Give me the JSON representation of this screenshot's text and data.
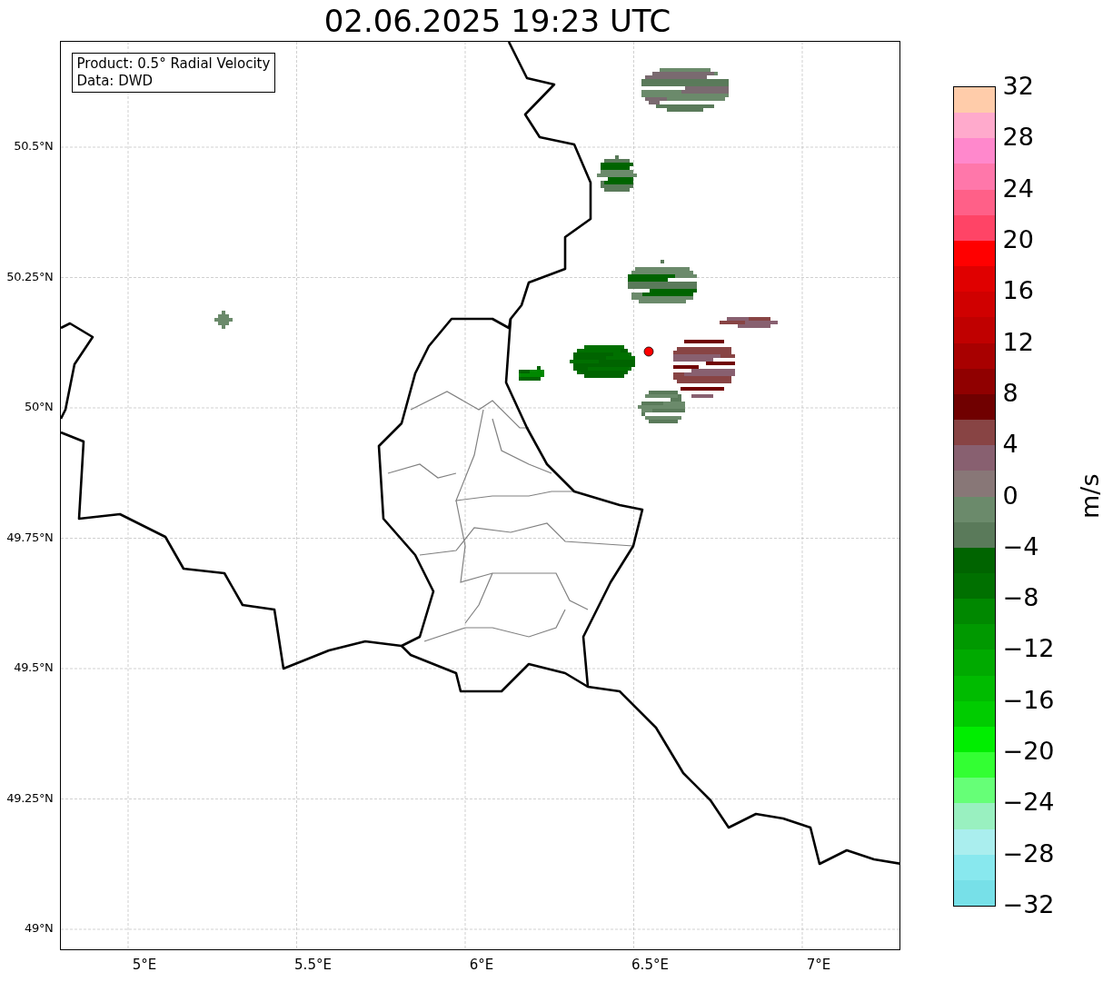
{
  "title": "02.06.2025 19:23 UTC",
  "map": {
    "info_box": [
      "Product: 0.5° Radial Velocity",
      "Data: DWD"
    ],
    "lat_ticks": [
      "50.5°N",
      "50.25°N",
      "50°N",
      "49.75°N",
      "49.5°N",
      "49.25°N",
      "49°N"
    ],
    "lon_ticks": [
      "5°E",
      "5.5°E",
      "6°E",
      "6.5°E",
      "7°E"
    ]
  },
  "colorbar": {
    "label": "m/s",
    "ticks": [
      "32",
      "28",
      "24",
      "20",
      "16",
      "12",
      "8",
      "4",
      "0",
      "−4",
      "−8",
      "−12",
      "−16",
      "−20",
      "−24",
      "−28",
      "−32"
    ],
    "segments": [
      {
        "color": "#ffccaa"
      },
      {
        "color": "#ffaacc"
      },
      {
        "color": "#ff88cc"
      },
      {
        "color": "#ff77aa"
      },
      {
        "color": "#ff6088"
      },
      {
        "color": "#ff4466"
      },
      {
        "color": "#ff0000"
      },
      {
        "color": "#e00000"
      },
      {
        "color": "#d00000"
      },
      {
        "color": "#c00000"
      },
      {
        "color": "#a80000"
      },
      {
        "color": "#900000"
      },
      {
        "color": "#700000"
      },
      {
        "color": "#884444"
      },
      {
        "color": "#886070"
      },
      {
        "color": "#887777"
      },
      {
        "color": "#6b8a6b"
      },
      {
        "color": "#5a7a5a"
      },
      {
        "color": "#006400"
      },
      {
        "color": "#007000"
      },
      {
        "color": "#008800"
      },
      {
        "color": "#009900"
      },
      {
        "color": "#00aa00"
      },
      {
        "color": "#00bb00"
      },
      {
        "color": "#00cc00"
      },
      {
        "color": "#00ee00"
      },
      {
        "color": "#33ff33"
      },
      {
        "color": "#66ff77"
      },
      {
        "color": "#99f0c0"
      },
      {
        "color": "#aaeeee"
      },
      {
        "color": "#88e8ee"
      },
      {
        "color": "#77e0e8"
      }
    ]
  }
}
